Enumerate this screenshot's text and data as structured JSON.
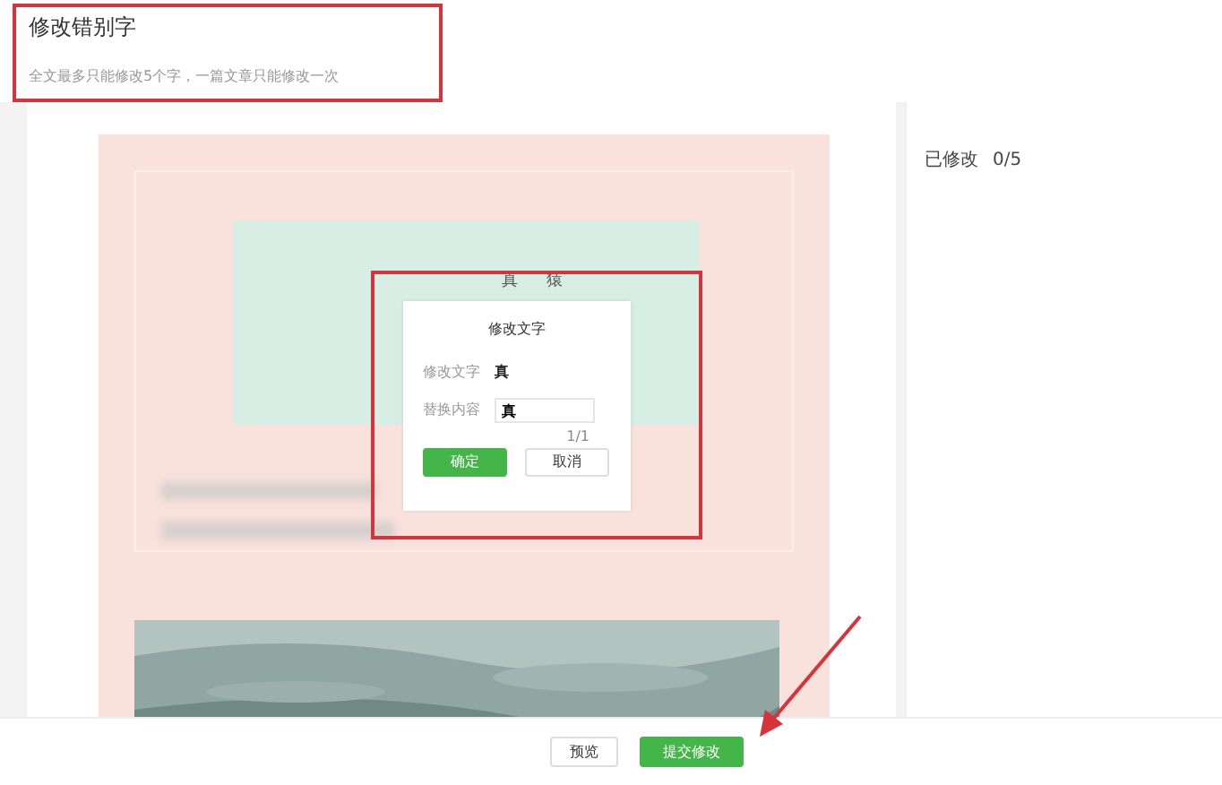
{
  "header": {
    "title": "修改错别字",
    "subtitle": "全文最多只能修改5个字，一篇文章只能修改一次"
  },
  "status": {
    "label": "已修改",
    "count": "0/5"
  },
  "article": {
    "marked_chars": [
      "真",
      "猿"
    ]
  },
  "dialog": {
    "title": "修改文字",
    "original_label": "修改文字",
    "original_value": "真",
    "replace_label": "替换内容",
    "replace_value": "真",
    "counter": "1/1",
    "buttons": [
      {
        "label": "确定",
        "kind": "primary"
      },
      {
        "label": "取消",
        "kind": "secondary"
      }
    ]
  },
  "footer_buttons": [
    {
      "label": "预览",
      "kind": "secondary"
    },
    {
      "label": "提交修改",
      "kind": "primary"
    }
  ]
}
